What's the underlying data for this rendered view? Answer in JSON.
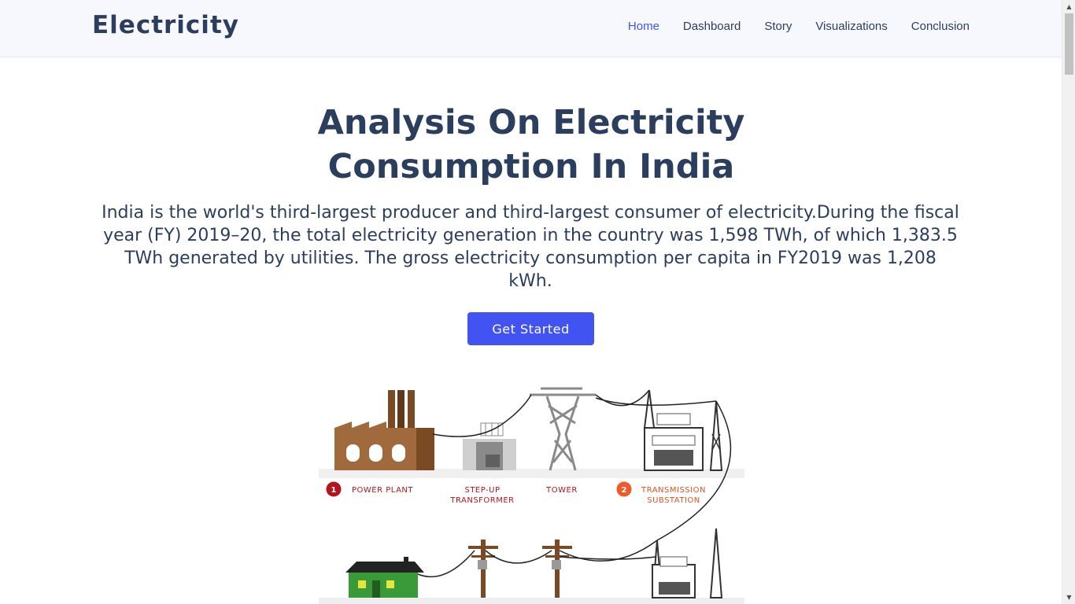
{
  "brand": {
    "name": "Electricity"
  },
  "nav": {
    "items": [
      {
        "label": "Home",
        "active": true
      },
      {
        "label": "Dashboard",
        "active": false
      },
      {
        "label": "Story",
        "active": false
      },
      {
        "label": "Visualizations",
        "active": false
      },
      {
        "label": "Conclusion",
        "active": false
      }
    ]
  },
  "hero": {
    "title": "Analysis On Electricity Consumption In India",
    "description": "India is the world's third-largest producer and third-largest consumer of electricity.During the fiscal year (FY) 2019–20, the total electricity generation in the country was 1,598 TWh, of which 1,383.5 TWh generated by utilities. The gross electricity consumption per capita in FY2019 was 1,208 kWh.",
    "cta_label": "Get Started"
  },
  "illustration": {
    "labels": {
      "step1_number": "1",
      "power_plant": "POWER PLANT",
      "step_up_line1": "STEP-UP",
      "step_up_line2": "TRANSFORMER",
      "tower": "TOWER",
      "step2_number": "2",
      "substation_line1": "TRANSMISSION",
      "substation_line2": "SUBSTATION"
    }
  },
  "colors": {
    "accent": "#4154f1",
    "heading": "#2c3e5d",
    "label_red": "#b5141e",
    "step2_orange": "#f05a28",
    "factory_brown": "#a06a3c",
    "house_green": "#3a9a3a"
  }
}
